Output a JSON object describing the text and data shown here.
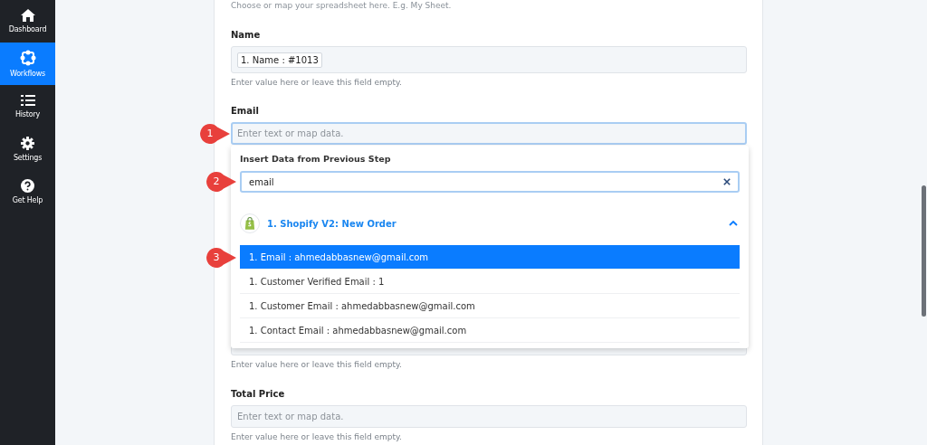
{
  "sidebar": {
    "items": [
      {
        "label": "Dashboard",
        "selected": false
      },
      {
        "label": "Workflows",
        "selected": true
      },
      {
        "label": "History",
        "selected": false
      },
      {
        "label": "Settings",
        "selected": false
      },
      {
        "label": "Get Help",
        "selected": false
      }
    ]
  },
  "form": {
    "intro": "Choose or map your spreadsheet here. E.g. My Sheet.",
    "fields": [
      {
        "label": "Name",
        "tokens": [
          "1. Name : #1013"
        ],
        "hint": "Enter value here or leave this field empty.",
        "focused": false
      },
      {
        "label": "Email",
        "placeholder": "Enter text or map data.",
        "focused": true,
        "marker": "1",
        "dropdown": {
          "title": "Insert Data from Previous Step",
          "search": {
            "value": "email",
            "marker": "2"
          },
          "app": {
            "name": "1. Shopify V2: New Order",
            "expanded": true
          },
          "options": [
            {
              "label": "1. Email : ahmedabbasnew@gmail.com",
              "selected": true,
              "marker": "3"
            },
            {
              "label": "1. Customer Verified Email : 1",
              "selected": false
            },
            {
              "label": "1. Customer Email : ahmedabbasnew@gmail.com",
              "selected": false
            },
            {
              "label": "1. Contact Email : ahmedabbasnew@gmail.com",
              "selected": false
            }
          ]
        }
      },
      {
        "hint": "Enter value here or leave this field empty.",
        "focused": false
      },
      {
        "label": "Total Price",
        "placeholder": "Enter text or map data.",
        "hint": "Enter value here or leave this field empty.",
        "focused": false
      }
    ]
  }
}
